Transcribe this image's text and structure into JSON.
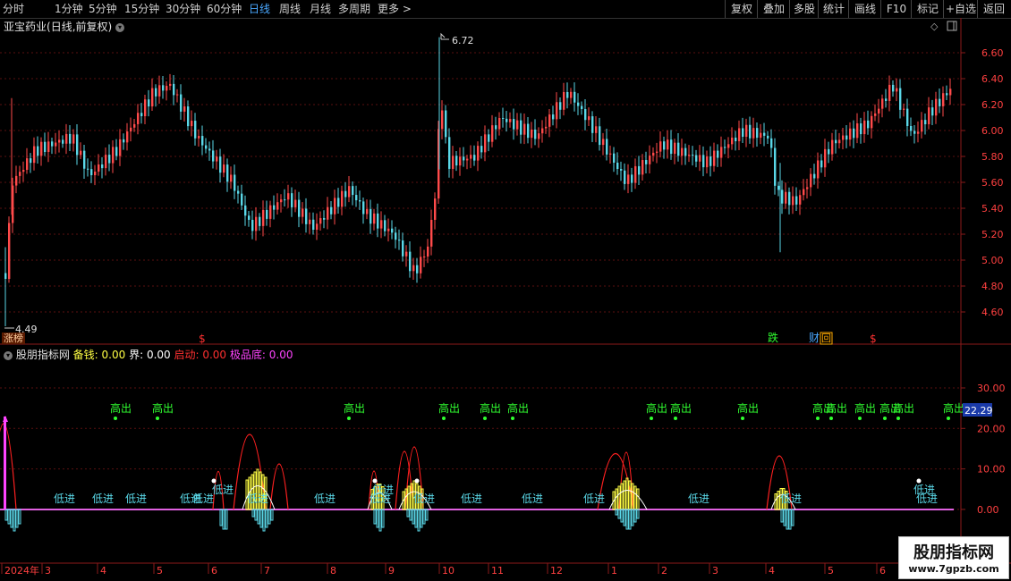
{
  "toolbar": {
    "left": [
      "分时",
      "1分钟",
      "5分钟",
      "15分钟",
      "30分钟",
      "60分钟",
      "日线",
      "周线",
      "月线",
      "多周期",
      "更多 >"
    ],
    "active": "日线",
    "right": [
      "复权",
      "叠加",
      "多股",
      "统计",
      "画线",
      "F10",
      "标记",
      "+自选",
      "返回"
    ]
  },
  "stock": {
    "name": "亚宝药业",
    "mode": "(日线,前复权)"
  },
  "price_axis": [
    "6.60",
    "6.40",
    "6.20",
    "6.00",
    "5.80",
    "5.60",
    "5.40",
    "5.20",
    "5.00",
    "4.80",
    "4.60"
  ],
  "high_label": "6.72",
  "low_label": "4.49",
  "badges": {
    "zhangbang": "涨榜",
    "dollar": "$",
    "die": "跌",
    "cai": "财",
    "hui": "回"
  },
  "indicator": {
    "name": "股朋指标网",
    "items": [
      {
        "label": "备钱: ",
        "value": "0.00",
        "color": "#ffff44"
      },
      {
        "label": "界: ",
        "value": "0.00",
        "color": "#ffffff"
      },
      {
        "label": "启动: ",
        "value": "0.00",
        "color": "#ff3030"
      },
      {
        "label": "极品底: ",
        "value": "0.00",
        "color": "#ff44ff"
      }
    ],
    "axis": [
      "30.00",
      "20.00",
      "10.00",
      "0.00"
    ],
    "current": "22.29",
    "signal_high": "高出",
    "signal_low": "低进"
  },
  "date_axis": [
    "2024年",
    "3",
    "4",
    "5",
    "6",
    "7",
    "8",
    "9",
    "10",
    "11",
    "12",
    "1",
    "2",
    "3",
    "4",
    "5",
    "6"
  ],
  "watermark": {
    "title": "股朋指标网",
    "url": "www.7gpzb.com"
  }
}
